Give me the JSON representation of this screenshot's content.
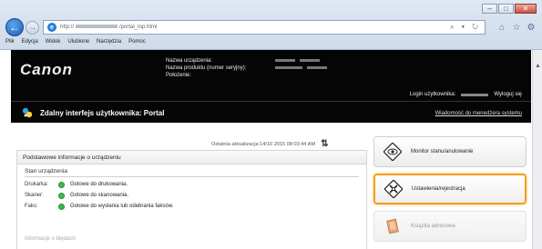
{
  "browser": {
    "address_prefix": "http://",
    "address_suffix": "/portal_top.html",
    "address_tools": "⌕ ▾ ↻",
    "menu": [
      "Plik",
      "Edycja",
      "Widok",
      "Ulubione",
      "Narzędzia",
      "Pomoc"
    ]
  },
  "header": {
    "logo": "Canon",
    "device_name_label": "Nazwa urządzenia:",
    "product_name_label": "Nazwa produktu (numer seryjny):",
    "location_label": "Położenie:",
    "login_label": "Login użytkownika:",
    "logout_label": "Wyloguj się",
    "portal_title": "Zdalny interfejs użytkownika: Portal",
    "manager_message": "Wiadomość do menedżera systemu"
  },
  "main": {
    "last_update": "Ostatnia aktualizacja:14/10 2015 08:03:44 AM",
    "panel_heading": "Podstawowe informacje o urządzeniu",
    "device_status_label": "Stan urządzenia",
    "statuses": [
      {
        "device": "Drukarka:",
        "text": "Gotowe do drukowania.",
        "color": "#3cb94a"
      },
      {
        "device": "Skaner:",
        "text": "Gotowe do skanowania.",
        "color": "#3cb94a"
      },
      {
        "device": "Faks:",
        "text": "Gotowe do wysłania lub odebrania faksów.",
        "color": "#3cb94a"
      }
    ],
    "error_info_label": "Informacje o błędach"
  },
  "side_menu": {
    "monitor": "Monitor stanu/anulowanie",
    "settings": "Ustawienia/rejestracja",
    "address_book": "Książka adresowa"
  },
  "colors": {
    "highlight": "#f0a01e",
    "status_ok": "#3cb94a",
    "header_bg": "#050505"
  }
}
